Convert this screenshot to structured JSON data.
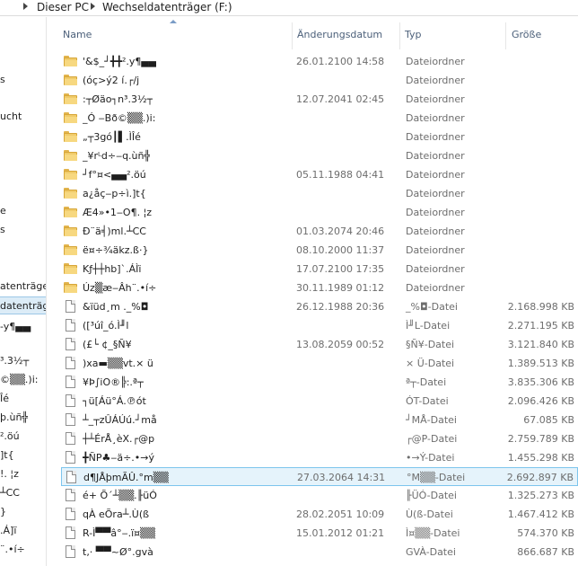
{
  "address_bar": {
    "crumbs": [
      "Dieser PC",
      "Wechseldatenträger (F:)"
    ]
  },
  "nav_pane": {
    "items": [
      "s",
      "ucht",
      "e",
      "s",
      "atenträger",
      "datenträger",
      "-y¶▄▄",
      "³.3½┬",
      "©▒▒.)i:",
      "Îé",
      "þ.ùñ╬",
      "².öú",
      "]t{",
      "!. ¦z",
      "┴CC",
      "}",
      ".Á]ï",
      "¨.•í÷"
    ],
    "selected_index": 5
  },
  "columns": {
    "name": "Name",
    "date": "Änderungsdatum",
    "type": "Typ",
    "size": "Größe"
  },
  "rows": [
    {
      "kind": "folder",
      "name": "'&$_┘╋╋².y¶▄▄",
      "date": "26.01.2100 14:58",
      "type": "Dateiordner",
      "size": ""
    },
    {
      "kind": "folder",
      "name": "(óç>ý2 í.┌/j",
      "date": "",
      "type": "Dateiordner",
      "size": ""
    },
    {
      "kind": "folder",
      "name": ":┬Øäo┐n³.3½┬",
      "date": "12.07.2041 02:45",
      "type": "Dateiordner",
      "size": ""
    },
    {
      "kind": "folder",
      "name": "_Ó   ‒Bð©▒▒.)i:",
      "date": "",
      "type": "Dateiordner",
      "size": ""
    },
    {
      "kind": "folder",
      "name": "„┬3gó┃▌.ÌÎé",
      "date": "",
      "type": "Dateiordner",
      "size": ""
    },
    {
      "kind": "folder",
      "name": "_¥rᴸd÷‒q.ùñ╬",
      "date": "",
      "type": "Dateiordner",
      "size": ""
    },
    {
      "kind": "folder",
      "name": "┘f°¤<▄▄².öú",
      "date": "05.11.1988 04:41",
      "type": "Dateiordner",
      "size": ""
    },
    {
      "kind": "folder",
      "name": "a¿åç‒p÷ì.]t{",
      "date": "",
      "type": "Dateiordner",
      "size": ""
    },
    {
      "kind": "folder",
      "name": "Æ4»•1‒O¶.  ¦z",
      "date": "",
      "type": "Dateiordner",
      "size": ""
    },
    {
      "kind": "folder",
      "name": "Ð¨ä╡)ml.┴CC",
      "date": "01.03.2074 20:46",
      "type": "Dateiordner",
      "size": ""
    },
    {
      "kind": "folder",
      "name": "ë¤÷¾äkz.ß‧}",
      "date": "08.10.2000 11:37",
      "type": "Dateiordner",
      "size": ""
    },
    {
      "kind": "folder",
      "name": "Kƒ┼┼hb]`.ÁÌï",
      "date": "17.07.2100 17:35",
      "type": "Dateiordner",
      "size": ""
    },
    {
      "kind": "folder",
      "name": "Úz▒æ‒Âh¨.•í÷",
      "date": "30.11.1989 01:12",
      "type": "Dateiordner",
      "size": ""
    },
    {
      "kind": "file",
      "name": "&ïüd¸m ._%◘",
      "date": "26.12.1988 20:36",
      "type": "_%◘-Datei",
      "size": "2.168.998 KB"
    },
    {
      "kind": "file",
      "name": "([³úî_ó.Ì╜l",
      "date": "",
      "type": "Ì╜L-Datei",
      "size": "2.271.195 KB"
    },
    {
      "kind": "file",
      "name": "   (£└ ¢_§Ñ¥",
      "date": "13.08.2059 00:52",
      "type": "§Ñ¥-Datei",
      "size": "3.121.840 KB"
    },
    {
      "kind": "file",
      "name": ")xa▬▒▒vt.× ü",
      "date": "",
      "type": "× Ü-Datei",
      "size": "1.389.513 KB"
    },
    {
      "kind": "file",
      "name": "¥Þ∫iO®╠:.ª┬",
      "date": "",
      "type": "ª┬-Datei",
      "size": "3.835.306 KB"
    },
    {
      "kind": "file",
      "name": "┐ü[Áü°Á.℗ót",
      "date": "",
      "type": "ÓT-Datei",
      "size": "2.096.426 KB"
    },
    {
      "kind": "file",
      "name": "┴_┬zÛÁÚú.┘må",
      "date": "",
      "type": "┘MÅ-Datei",
      "size": "67.085 KB"
    },
    {
      "kind": "file",
      "name": "┼┴ÉrÅ¸èX.┌@p",
      "date": "",
      "type": "┌@P-Datei",
      "size": "2.759.789 KB"
    },
    {
      "kind": "file",
      "name": "   ╋ÑP♣‒ä÷.•→ý",
      "date": "",
      "type": "•→Ý-Datei",
      "size": "1.455.298 KB"
    },
    {
      "kind": "file",
      "name": "d¶JÅþmÃÛ.°m▒▒",
      "date": "27.03.2064 14:31",
      "type": "°M▒▒-Datei",
      "size": "2.692.897 KB",
      "selected": true
    },
    {
      "kind": "file",
      "name": "é+ Õ´┴▒▒.╟üÓ",
      "date": "",
      "type": "╟ÜÓ-Datei",
      "size": "1.325.273 KB"
    },
    {
      "kind": "file",
      "name": "qÀ eÕra┴.Ù(ß",
      "date": "28.02.2051 10:09",
      "type": "Ù(ß-Datei",
      "size": "1.467.412 KB"
    },
    {
      "kind": "file",
      "name": "R-Ì▀▀â°‒.ï¤▒▒",
      "date": "15.01.2012 01:21",
      "type": "Ì¤▒▒-Datei",
      "size": "574.370 KB"
    },
    {
      "kind": "file",
      "name": "t,· ▀▀~Ø°.gvà",
      "date": "",
      "type": "GVÀ-Datei",
      "size": "866.687 KB"
    }
  ]
}
